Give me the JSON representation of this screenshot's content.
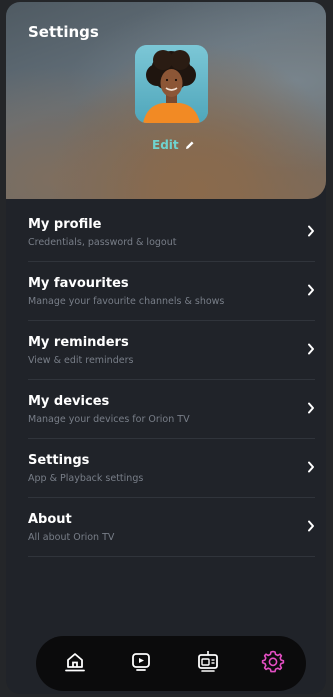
{
  "header": {
    "title": "Settings",
    "edit_label": "Edit"
  },
  "menu": {
    "items": [
      {
        "title": "My profile",
        "subtitle": "Credentials, password & logout"
      },
      {
        "title": "My favourites",
        "subtitle": "Manage your favourite channels & shows"
      },
      {
        "title": "My reminders",
        "subtitle": "View & edit reminders"
      },
      {
        "title": "My devices",
        "subtitle": "Manage your devices for Orion TV"
      },
      {
        "title": "Settings",
        "subtitle": "App & Playback settings"
      },
      {
        "title": "About",
        "subtitle": "All about Orion TV"
      }
    ]
  },
  "navbar": {
    "items": [
      "home-icon",
      "play-icon",
      "tv-icon",
      "gear-icon"
    ],
    "active": "gear-icon"
  },
  "colors": {
    "accent_edit": "#6fd3cf",
    "active_nav": "#e44fc4",
    "background": "#202329"
  }
}
